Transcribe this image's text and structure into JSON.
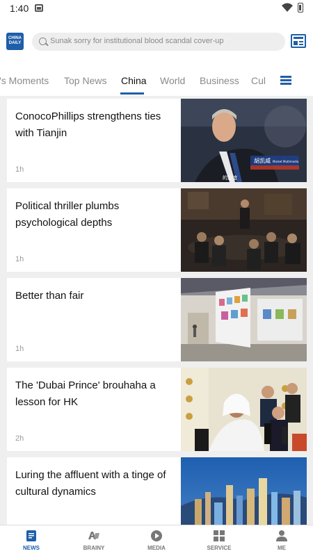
{
  "status": {
    "time": "1:40"
  },
  "brand": {
    "logo_text": "CHINA DAILY",
    "color": "#1f5ea8"
  },
  "search": {
    "placeholder": "Sunak sorry for institutional blood scandal cover-up"
  },
  "tabs": [
    {
      "label": "i's Moments",
      "active": false
    },
    {
      "label": "Top News",
      "active": false
    },
    {
      "label": "China",
      "active": true
    },
    {
      "label": "World",
      "active": false
    },
    {
      "label": "Business",
      "active": false
    },
    {
      "label": "Cul",
      "active": false
    }
  ],
  "articles": [
    {
      "title": "ConocoPhillips strengthens ties with Tianjin",
      "time": "1h",
      "image": "interview-man-in-suit"
    },
    {
      "title": "Political thriller plumbs psychological depths",
      "time": "1h",
      "image": "film-scene-meeting"
    },
    {
      "title": "Better than fair",
      "time": "1h",
      "image": "art-fair-booth"
    },
    {
      "title": "The 'Dubai Prince' brouhaha a lesson for HK",
      "time": "2h",
      "image": "press-conference"
    },
    {
      "title": "Luring the affluent with a tinge of cultural dynamics",
      "time": "",
      "image": "city-skyline-night"
    }
  ],
  "image_captions": {
    "caption_1": "胡凯威",
    "caption_2": "Market Multimedia",
    "caption_3": "的友谊"
  },
  "bottom_nav": [
    {
      "label": "NEWS",
      "icon": "news-icon",
      "active": true
    },
    {
      "label": "BRAINY",
      "icon": "brainy-icon",
      "active": false
    },
    {
      "label": "MEDIA",
      "icon": "media-icon",
      "active": false
    },
    {
      "label": "SERVICE",
      "icon": "service-icon",
      "active": false
    },
    {
      "label": "ME",
      "icon": "person-icon",
      "active": false
    }
  ]
}
